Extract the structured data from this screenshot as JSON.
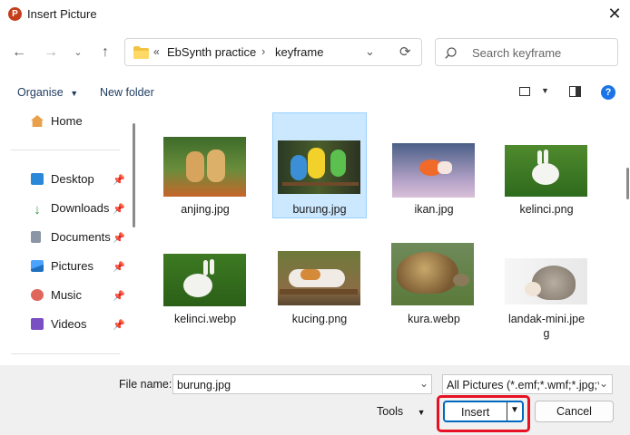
{
  "window": {
    "title": "Insert Picture",
    "app_icon_letter": "P"
  },
  "address": {
    "folder_icon": "folder-icon",
    "chevrons": "«",
    "crumbs": [
      "EbSynth practice",
      "keyframe"
    ],
    "separator": "›"
  },
  "search": {
    "placeholder": "Search keyframe"
  },
  "toolbar": {
    "organise": "Organise",
    "new_folder": "New folder"
  },
  "sidebar": {
    "top": [
      {
        "label": "Home",
        "icon": "home-icon"
      }
    ],
    "items": [
      {
        "label": "Desktop",
        "icon": "desktop-icon",
        "pinned": true,
        "color": "#2b88d8"
      },
      {
        "label": "Downloads",
        "icon": "download-icon",
        "pinned": true,
        "color": "#2e9a4a"
      },
      {
        "label": "Documents",
        "icon": "document-icon",
        "pinned": true,
        "color": "#7a8595"
      },
      {
        "label": "Pictures",
        "icon": "picture-icon",
        "pinned": true,
        "color": "#1f78c8"
      },
      {
        "label": "Music",
        "icon": "music-icon",
        "pinned": true,
        "color": "#e0655a"
      },
      {
        "label": "Videos",
        "icon": "video-icon",
        "pinned": true,
        "color": "#7b4fc4"
      }
    ]
  },
  "files": [
    {
      "name": "anjing.jpg",
      "selected": false
    },
    {
      "name": "burung.jpg",
      "selected": true
    },
    {
      "name": "ikan.jpg",
      "selected": false
    },
    {
      "name": "kelinci.png",
      "selected": false
    },
    {
      "name": "kelinci.webp",
      "selected": false
    },
    {
      "name": "kucing.png",
      "selected": false
    },
    {
      "name": "kura.webp",
      "selected": false
    },
    {
      "name": "landak-mini.jpe",
      "name2": "g",
      "selected": false
    }
  ],
  "bottom": {
    "file_name_label": "File name:",
    "file_name_value": "burung.jpg",
    "filter": "All Pictures (*.emf;*.wmf;*.jpg;*",
    "tools": "Tools",
    "insert": "Insert",
    "cancel": "Cancel"
  },
  "colors": {
    "accent": "#0067c0",
    "selection": "#cce8ff",
    "highlight": "#e81123"
  }
}
